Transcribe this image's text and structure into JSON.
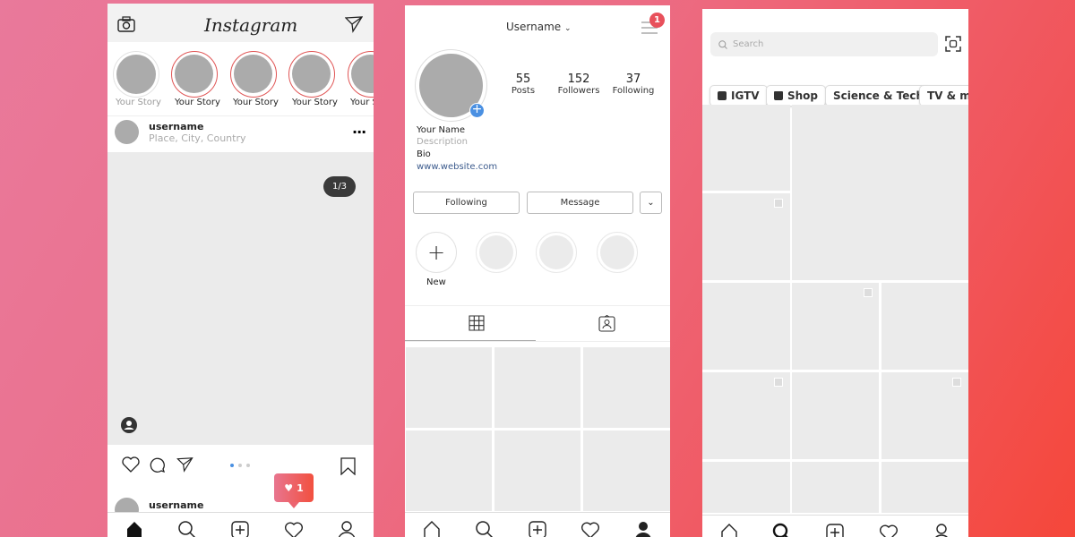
{
  "feed": {
    "logo": "Instagram",
    "stories": [
      {
        "label": "Your Story",
        "own": true
      },
      {
        "label": "Your Story"
      },
      {
        "label": "Your Story"
      },
      {
        "label": "Your Story"
      },
      {
        "label": "Your Story"
      }
    ],
    "post": {
      "username": "username",
      "location": "Place, City, Country",
      "counter": "1/3",
      "next_username": "username"
    },
    "notification": {
      "count": "1",
      "color": "#f05050"
    },
    "carousel_active_color": "#4a90e2"
  },
  "profile": {
    "username": "Username",
    "menu_badge": "1",
    "stats": [
      {
        "value": "55",
        "label": "Posts"
      },
      {
        "value": "152",
        "label": "Followers"
      },
      {
        "value": "37",
        "label": "Following"
      }
    ],
    "name": "Your Name",
    "description": "Description",
    "bio": "Bio",
    "website": "www.website.com",
    "following_button": "Following",
    "message_button": "Message",
    "new_highlight": "New",
    "add_color": "#4a90e2"
  },
  "explore": {
    "search_placeholder": "Search",
    "chips": [
      "IGTV",
      "Shop",
      "Science & Tech",
      "TV & movies"
    ]
  }
}
